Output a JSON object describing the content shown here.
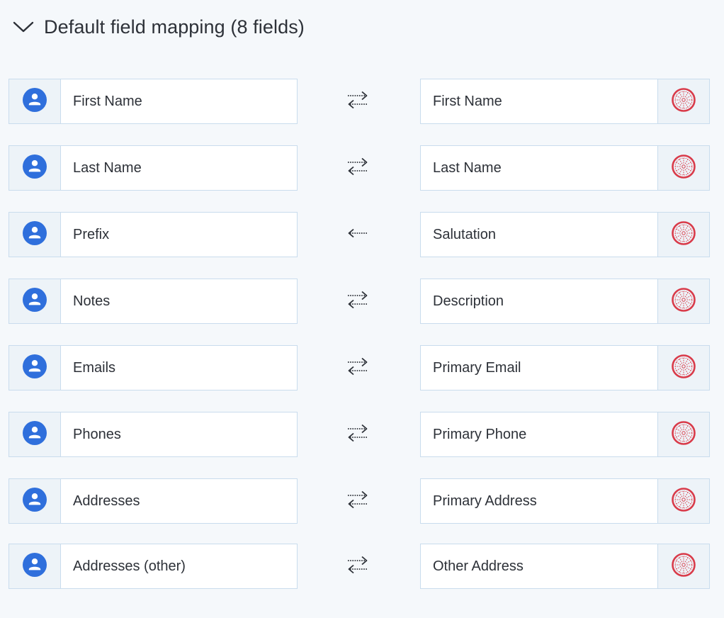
{
  "header": {
    "title": "Default field mapping (8 fields)",
    "chevron_icon": "chevron-down-icon"
  },
  "colors": {
    "google_contacts_blue": "#2f6fdc",
    "salesforce_red": "#d93b4a",
    "border": "#c9dced",
    "icon_cell_bg": "#edf3f8",
    "page_bg": "#f5f8fb"
  },
  "mappings": [
    {
      "left": "First Name",
      "right": "First Name",
      "direction": "bidirectional"
    },
    {
      "left": "Last Name",
      "right": "Last Name",
      "direction": "bidirectional"
    },
    {
      "left": "Prefix",
      "right": "Salutation",
      "direction": "right-to-left"
    },
    {
      "left": "Notes",
      "right": "Description",
      "direction": "bidirectional"
    },
    {
      "left": "Emails",
      "right": "Primary Email",
      "direction": "bidirectional"
    },
    {
      "left": "Phones",
      "right": "Primary Phone",
      "direction": "bidirectional"
    },
    {
      "left": "Addresses",
      "right": "Primary Address",
      "direction": "bidirectional"
    },
    {
      "left": "Addresses (other)",
      "right": "Other Address",
      "direction": "bidirectional"
    }
  ]
}
